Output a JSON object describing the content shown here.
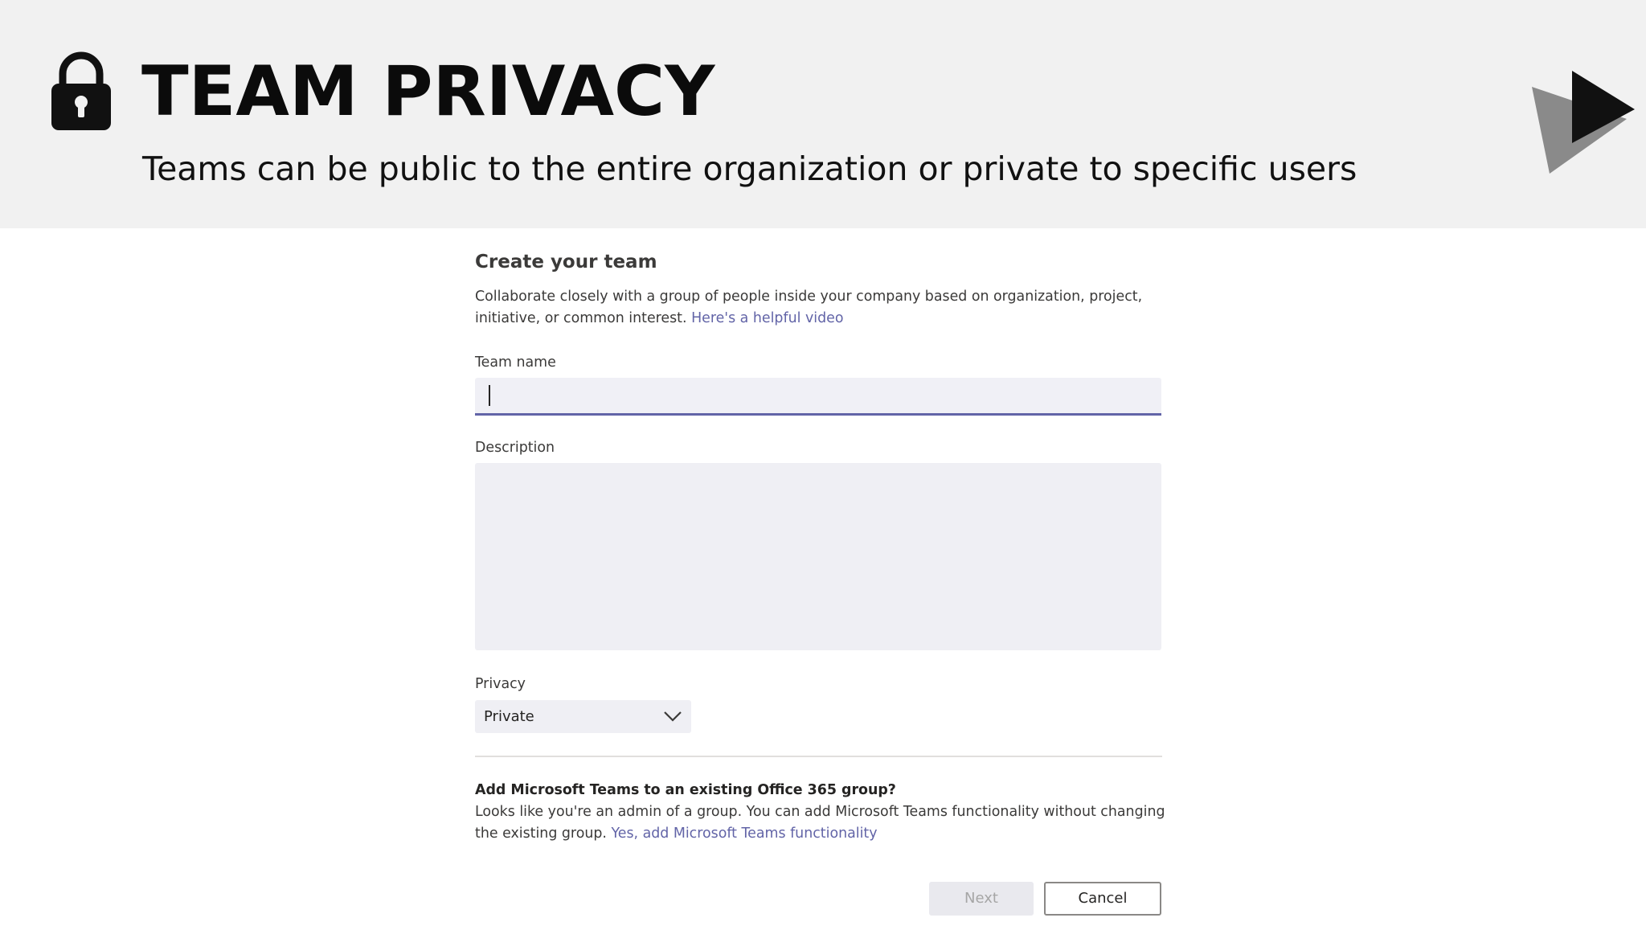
{
  "banner": {
    "title": "TEAM PRIVACY",
    "subtitle": "Teams can be public to the entire organization or private to specific users",
    "icons": [
      "lock-icon",
      "play-icon"
    ]
  },
  "dialog": {
    "title": "Create your team",
    "description": "Collaborate closely with a group of people inside your company based on organization, project, initiative, or common interest.",
    "video_link": "Here's a helpful video",
    "team_name_label": "Team name",
    "team_name_value": "",
    "description_label": "Description",
    "description_value": "",
    "privacy_label": "Privacy",
    "privacy_value": "Private",
    "existing_group_heading": "Add Microsoft Teams to an existing Office 365 group?",
    "existing_group_text": "Looks like you're an admin of a group. You can add Microsoft Teams functionality without changing the existing group.",
    "existing_group_link": "Yes, add Microsoft Teams functionality",
    "next_label": "Next",
    "cancel_label": "Cancel"
  },
  "colors": {
    "banner_bg": "#f1f1f1",
    "accent": "#6264a7",
    "input_bg": "#f0f0f6"
  }
}
